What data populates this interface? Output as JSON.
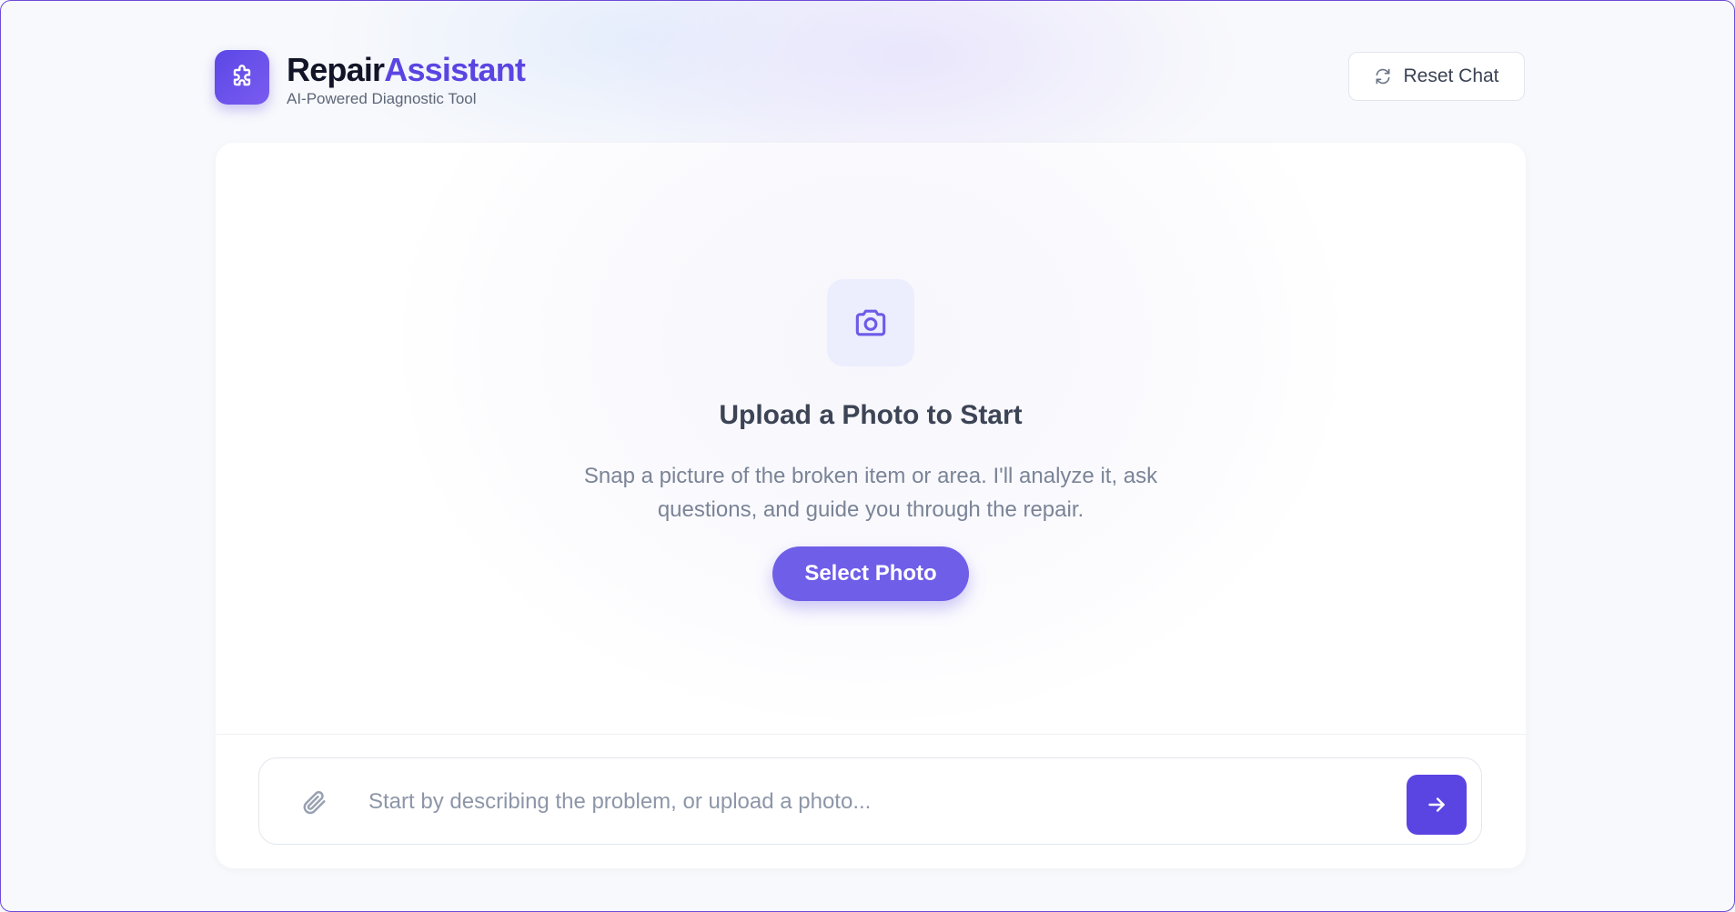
{
  "app": {
    "brand_part1": "Repair",
    "brand_part2": "Assistant",
    "subtitle": "AI-Powered Diagnostic Tool"
  },
  "header": {
    "reset_label": "Reset Chat"
  },
  "empty_state": {
    "title": "Upload a Photo to Start",
    "description": "Snap a picture of the broken item or area. I'll analyze it, ask questions, and guide you through the repair.",
    "select_button": "Select Photo"
  },
  "composer": {
    "value": "",
    "placeholder": "Start by describing the problem, or upload a photo..."
  },
  "icons": {
    "logo": "puzzle-icon",
    "reset": "refresh-icon",
    "upload": "camera-icon",
    "attach": "paperclip-icon",
    "send": "arrow-right-icon"
  },
  "colors": {
    "accent": "#5a45e2",
    "button": "#6f5ee8",
    "background": "#f8f9fc"
  }
}
